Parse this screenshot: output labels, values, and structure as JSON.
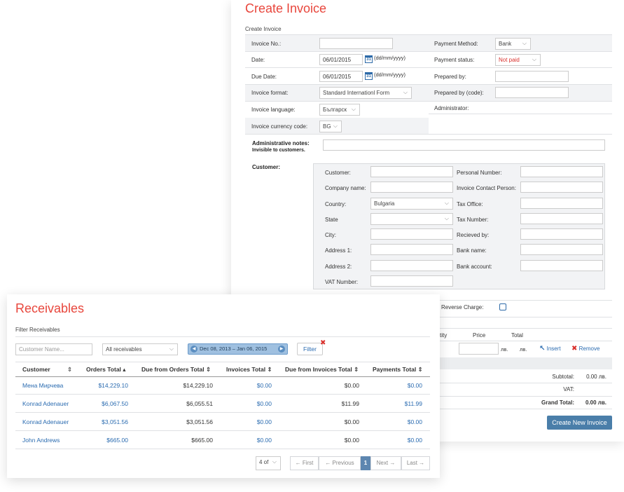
{
  "invoice": {
    "title": "Create Invoice",
    "breadcrumb": "Create Invoice",
    "fields": {
      "invoice_no_label": "Invoice No.:",
      "date_label": "Date:",
      "date_value": "06/01/2015",
      "date_hint": "(dd/mm/yyyy)",
      "due_date_label": "Due Date:",
      "due_date_value": "06/01/2015",
      "due_date_hint": "(dd/mm/yyyy)",
      "invoice_format_label": "Invoice format:",
      "invoice_format_value": "Standard Internationl Form",
      "invoice_language_label": "Invoice language:",
      "invoice_language_value": "Българск",
      "invoice_currency_label": "Invoice currency code:",
      "invoice_currency_value": "BG",
      "payment_method_label": "Payment Method:",
      "payment_method_value": "Bank",
      "payment_status_label": "Payment status:",
      "payment_status_value": "Not paid",
      "prepared_by_label": "Prepared by:",
      "prepared_by_code_label": "Prepared by (code):",
      "administrator_label": "Administrator:",
      "calendar_glyph": "31"
    },
    "admin_notes_label": "Administrative notes:",
    "admin_notes_sub": "Invisible to customers.",
    "customer_label": "Customer:",
    "customer_fields": {
      "customer": "Customer:",
      "company_name": "Company name:",
      "country": "Country:",
      "country_value": "Bulgaria",
      "state": "State",
      "city": "City:",
      "address1": "Address 1:",
      "address2": "Address 2:",
      "vat_number": "VAT Number:",
      "personal_number": "Personal Number:",
      "invoice_contact_person": "Invoice Contact Person:",
      "tax_office": "Tax Office:",
      "tax_number": "Tax Number:",
      "received_by": "Recieved by:",
      "bank_name": "Bank name:",
      "bank_account": "Bank account:"
    },
    "vat_reverse_label": "T Reverse Charge:",
    "items": {
      "col_quantity": "tity",
      "col_price": "Price",
      "col_total": "Total",
      "currency_suffix": "лв.",
      "insert_label": "Insert",
      "remove_label": "Remove"
    },
    "totals": {
      "subtotal_label": "Subtotal:",
      "subtotal_value": "0.00 лв.",
      "vat_label": "VAT:",
      "grand_total_label": "Grand Total:",
      "grand_total_value": "0.00 лв."
    },
    "create_button": "Create New Invoice"
  },
  "receivables": {
    "title": "Receivables",
    "filter_heading": "Filter Receivables",
    "customer_placeholder": "Customer Name...",
    "type_select": "All receivables",
    "date_range": "Dec 08, 2013 – Jan 06, 2015",
    "filter_button": "Filter",
    "columns": [
      "Customer",
      "Orders Total",
      "Due from Orders Total",
      "Invoices Total",
      "Due from Invoices Total",
      "Payments Total"
    ],
    "rows": [
      {
        "customer": "Мена Мирчева",
        "orders_total": "$14,229.10",
        "due_orders": "$14,229.10",
        "invoices_total": "$0.00",
        "due_invoices": "$0.00",
        "payments_total": "$0.00"
      },
      {
        "customer": "Konrad Adenauer",
        "orders_total": "$6,067.50",
        "due_orders": "$6,055.51",
        "invoices_total": "$0.00",
        "due_invoices": "$11.99",
        "payments_total": "$11.99"
      },
      {
        "customer": "Konrad Adenauer",
        "orders_total": "$3,051.56",
        "due_orders": "$3,051.56",
        "invoices_total": "$0.00",
        "due_invoices": "$0.00",
        "payments_total": "$0.00"
      },
      {
        "customer": "John Andrews",
        "orders_total": "$665.00",
        "due_orders": "$665.00",
        "invoices_total": "$0.00",
        "due_invoices": "$0.00",
        "payments_total": "$0.00"
      }
    ],
    "page_size": "4 of",
    "pager": {
      "first": "← First",
      "previous": "← Previous",
      "current": "1",
      "next": "Next →",
      "last": "Last →"
    },
    "sort_glyphs": {
      "both": "⇕",
      "up": "▴"
    }
  },
  "colors": {
    "accent_red": "#e8463c",
    "link_blue": "#2a6bb0",
    "button_blue": "#4a7ea9"
  }
}
